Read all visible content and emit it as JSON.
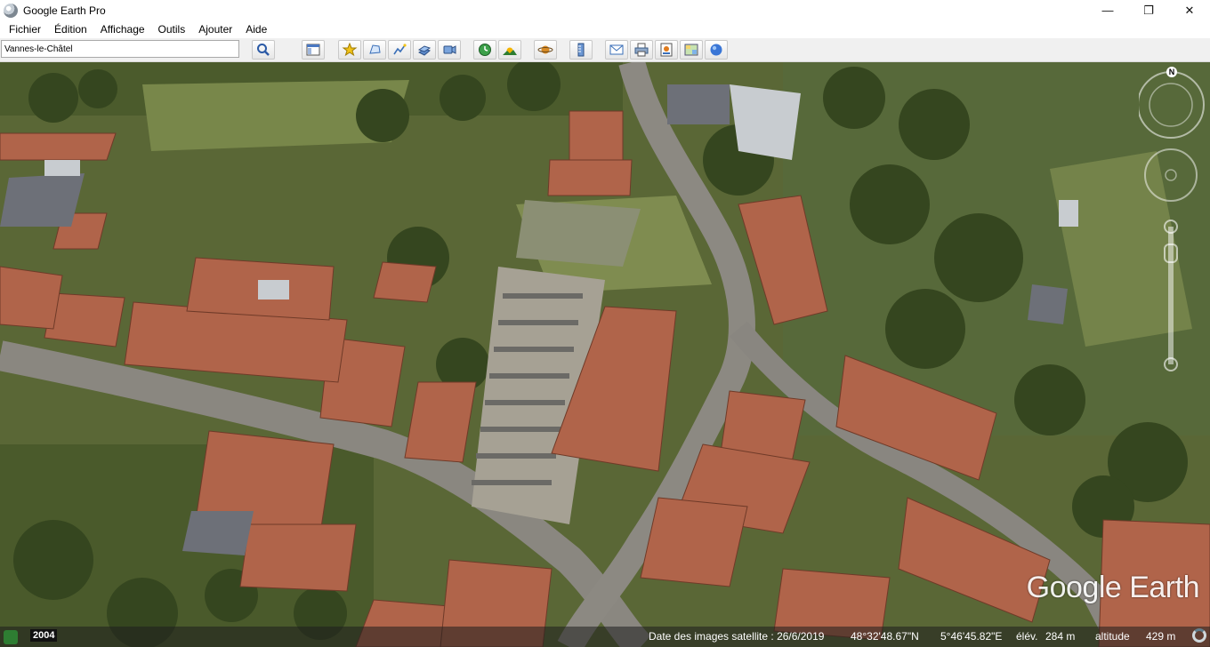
{
  "window": {
    "title": "Google Earth Pro",
    "minimize": "—",
    "maximize": "❐",
    "close": "✕"
  },
  "menu": [
    "Fichier",
    "Édition",
    "Affichage",
    "Outils",
    "Ajouter",
    "Aide"
  ],
  "search": {
    "value": "Vannes-le-Châtel"
  },
  "toolbar": {
    "icons": [
      "search-icon",
      "sidebar-icon",
      "placemark-icon",
      "polygon-icon",
      "path-icon",
      "overlay-icon",
      "tour-icon",
      "historical-imagery-icon",
      "sunlight-icon",
      "planets-icon",
      "ruler-icon",
      "email-icon",
      "print-icon",
      "save-image-icon",
      "map-icon",
      "maps-icon"
    ]
  },
  "navigation": {
    "compass_label": "N"
  },
  "watermark": "Google Earth",
  "status": {
    "year": "2004",
    "image_date": "Date des images satellite : 26/6/2019",
    "latitude": "48°32'48.67\"N",
    "longitude": "5°46'45.82\"E",
    "elevation_label": "élév.",
    "elevation": "284 m",
    "altitude_label": "altitude",
    "altitude": "429 m"
  }
}
